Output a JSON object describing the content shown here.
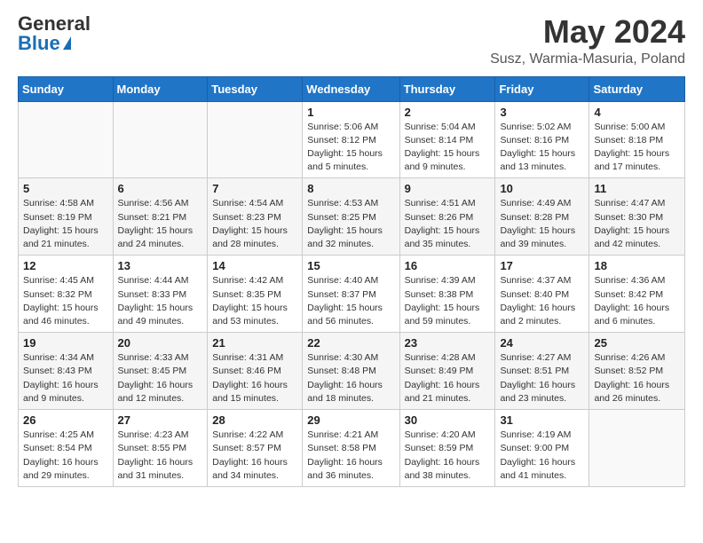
{
  "header": {
    "logo_general": "General",
    "logo_blue": "Blue",
    "title": "May 2024",
    "subtitle": "Susz, Warmia-Masuria, Poland"
  },
  "calendar": {
    "days_of_week": [
      "Sunday",
      "Monday",
      "Tuesday",
      "Wednesday",
      "Thursday",
      "Friday",
      "Saturday"
    ],
    "weeks": [
      [
        {
          "day": "",
          "info": ""
        },
        {
          "day": "",
          "info": ""
        },
        {
          "day": "",
          "info": ""
        },
        {
          "day": "1",
          "info": "Sunrise: 5:06 AM\nSunset: 8:12 PM\nDaylight: 15 hours\nand 5 minutes."
        },
        {
          "day": "2",
          "info": "Sunrise: 5:04 AM\nSunset: 8:14 PM\nDaylight: 15 hours\nand 9 minutes."
        },
        {
          "day": "3",
          "info": "Sunrise: 5:02 AM\nSunset: 8:16 PM\nDaylight: 15 hours\nand 13 minutes."
        },
        {
          "day": "4",
          "info": "Sunrise: 5:00 AM\nSunset: 8:18 PM\nDaylight: 15 hours\nand 17 minutes."
        }
      ],
      [
        {
          "day": "5",
          "info": "Sunrise: 4:58 AM\nSunset: 8:19 PM\nDaylight: 15 hours\nand 21 minutes."
        },
        {
          "day": "6",
          "info": "Sunrise: 4:56 AM\nSunset: 8:21 PM\nDaylight: 15 hours\nand 24 minutes."
        },
        {
          "day": "7",
          "info": "Sunrise: 4:54 AM\nSunset: 8:23 PM\nDaylight: 15 hours\nand 28 minutes."
        },
        {
          "day": "8",
          "info": "Sunrise: 4:53 AM\nSunset: 8:25 PM\nDaylight: 15 hours\nand 32 minutes."
        },
        {
          "day": "9",
          "info": "Sunrise: 4:51 AM\nSunset: 8:26 PM\nDaylight: 15 hours\nand 35 minutes."
        },
        {
          "day": "10",
          "info": "Sunrise: 4:49 AM\nSunset: 8:28 PM\nDaylight: 15 hours\nand 39 minutes."
        },
        {
          "day": "11",
          "info": "Sunrise: 4:47 AM\nSunset: 8:30 PM\nDaylight: 15 hours\nand 42 minutes."
        }
      ],
      [
        {
          "day": "12",
          "info": "Sunrise: 4:45 AM\nSunset: 8:32 PM\nDaylight: 15 hours\nand 46 minutes."
        },
        {
          "day": "13",
          "info": "Sunrise: 4:44 AM\nSunset: 8:33 PM\nDaylight: 15 hours\nand 49 minutes."
        },
        {
          "day": "14",
          "info": "Sunrise: 4:42 AM\nSunset: 8:35 PM\nDaylight: 15 hours\nand 53 minutes."
        },
        {
          "day": "15",
          "info": "Sunrise: 4:40 AM\nSunset: 8:37 PM\nDaylight: 15 hours\nand 56 minutes."
        },
        {
          "day": "16",
          "info": "Sunrise: 4:39 AM\nSunset: 8:38 PM\nDaylight: 15 hours\nand 59 minutes."
        },
        {
          "day": "17",
          "info": "Sunrise: 4:37 AM\nSunset: 8:40 PM\nDaylight: 16 hours\nand 2 minutes."
        },
        {
          "day": "18",
          "info": "Sunrise: 4:36 AM\nSunset: 8:42 PM\nDaylight: 16 hours\nand 6 minutes."
        }
      ],
      [
        {
          "day": "19",
          "info": "Sunrise: 4:34 AM\nSunset: 8:43 PM\nDaylight: 16 hours\nand 9 minutes."
        },
        {
          "day": "20",
          "info": "Sunrise: 4:33 AM\nSunset: 8:45 PM\nDaylight: 16 hours\nand 12 minutes."
        },
        {
          "day": "21",
          "info": "Sunrise: 4:31 AM\nSunset: 8:46 PM\nDaylight: 16 hours\nand 15 minutes."
        },
        {
          "day": "22",
          "info": "Sunrise: 4:30 AM\nSunset: 8:48 PM\nDaylight: 16 hours\nand 18 minutes."
        },
        {
          "day": "23",
          "info": "Sunrise: 4:28 AM\nSunset: 8:49 PM\nDaylight: 16 hours\nand 21 minutes."
        },
        {
          "day": "24",
          "info": "Sunrise: 4:27 AM\nSunset: 8:51 PM\nDaylight: 16 hours\nand 23 minutes."
        },
        {
          "day": "25",
          "info": "Sunrise: 4:26 AM\nSunset: 8:52 PM\nDaylight: 16 hours\nand 26 minutes."
        }
      ],
      [
        {
          "day": "26",
          "info": "Sunrise: 4:25 AM\nSunset: 8:54 PM\nDaylight: 16 hours\nand 29 minutes."
        },
        {
          "day": "27",
          "info": "Sunrise: 4:23 AM\nSunset: 8:55 PM\nDaylight: 16 hours\nand 31 minutes."
        },
        {
          "day": "28",
          "info": "Sunrise: 4:22 AM\nSunset: 8:57 PM\nDaylight: 16 hours\nand 34 minutes."
        },
        {
          "day": "29",
          "info": "Sunrise: 4:21 AM\nSunset: 8:58 PM\nDaylight: 16 hours\nand 36 minutes."
        },
        {
          "day": "30",
          "info": "Sunrise: 4:20 AM\nSunset: 8:59 PM\nDaylight: 16 hours\nand 38 minutes."
        },
        {
          "day": "31",
          "info": "Sunrise: 4:19 AM\nSunset: 9:00 PM\nDaylight: 16 hours\nand 41 minutes."
        },
        {
          "day": "",
          "info": ""
        }
      ]
    ]
  }
}
